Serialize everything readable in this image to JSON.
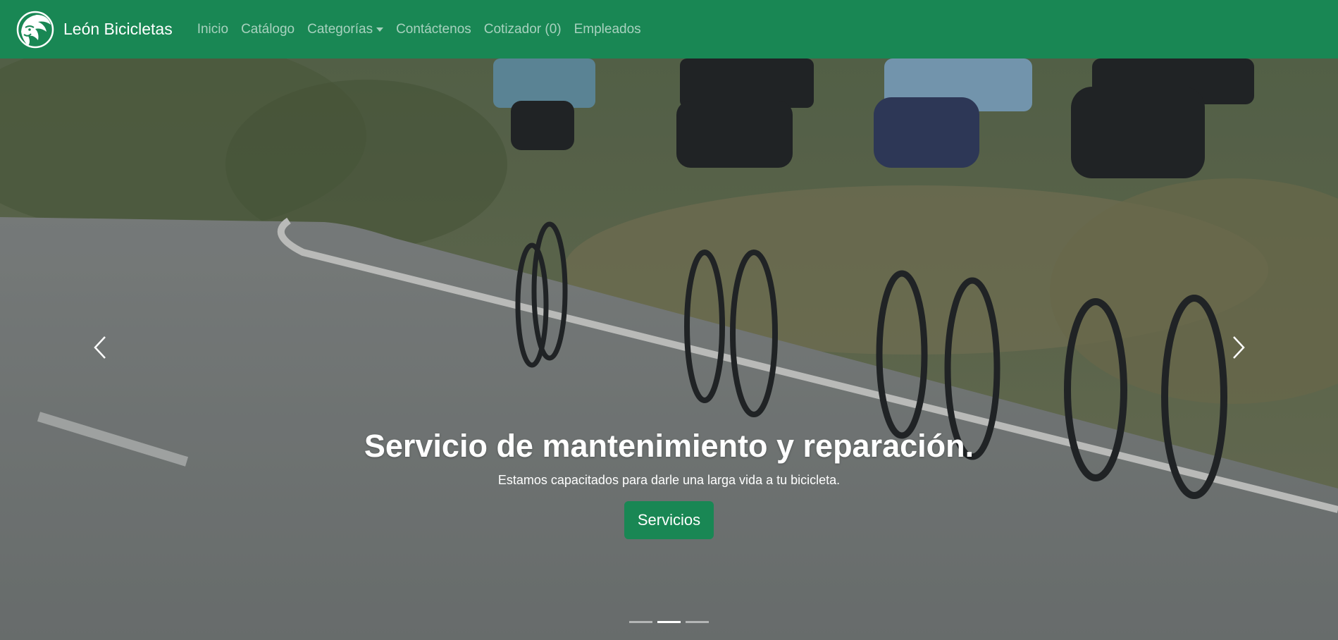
{
  "colors": {
    "brand": "#198754",
    "button": "#198754"
  },
  "navbar": {
    "brand_name": "León Bicicletas",
    "logo_icon": "lion-head-icon",
    "links": {
      "inicio": "Inicio",
      "catalogo": "Catálogo",
      "categorias": "Categorías",
      "contactenos": "Contáctenos",
      "cotizador": "Cotizador (0)",
      "empleados": "Empleados"
    }
  },
  "carousel": {
    "slide_image": "road-cyclists-photo",
    "caption": {
      "title": "Servicio de mantenimiento y reparación.",
      "text": "Estamos capacitados para darle una larga vida a tu bicicleta.",
      "button": "Servicios"
    },
    "controls": {
      "prev_icon": "chevron-left-icon",
      "next_icon": "chevron-right-icon"
    },
    "indicators": {
      "count": 3,
      "active_index": 1
    }
  }
}
